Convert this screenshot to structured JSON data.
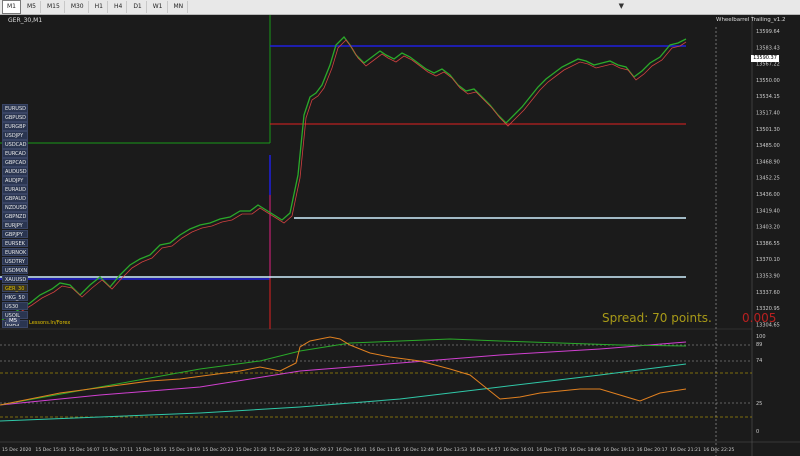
{
  "toolbar": {
    "timeframes": [
      "M1",
      "M5",
      "M15",
      "M30",
      "H1",
      "H4",
      "D1",
      "W1",
      "MN"
    ],
    "active": "M1"
  },
  "chart": {
    "symbol_title": "GER_30,M1",
    "indicator_label": "Wheelbarrel Trailing_v1.2",
    "current_price": "13590.37",
    "symbols": [
      "EURUSD",
      "GBPUSD",
      "EURGBP",
      "USDJPY",
      "USDCAD",
      "EURCAD",
      "GBPCAD",
      "AUDUSD",
      "AUDJPY",
      "EURAUD",
      "GBPAUD",
      "NZDUSD",
      "GBPNZD",
      "EURJPY",
      "GBPJPY",
      "EURSEK",
      "EURNOK",
      "USDTRY",
      "USDMXN",
      "XAUUSD",
      "GER_30",
      "HKG_50",
      "US30",
      "USOIL",
      "NGAS"
    ],
    "highlighted_symbol": "GER_30",
    "timeframe_box": "M5",
    "watermark": "Lessons.In/Forex",
    "spread_text": "Spread: 70 points.",
    "spread_value": "0.005",
    "price_labels": [
      "13599.64",
      "13583.43",
      "13567.22",
      "13550.00",
      "13534.15",
      "13517.40",
      "13501.30",
      "13485.00",
      "13468.90",
      "13452.25",
      "13436.00",
      "13419.40",
      "13403.20",
      "13386.55",
      "13370.10",
      "13353.90",
      "13337.60",
      "13320.95",
      "13304.65"
    ],
    "indicator_scale": [
      "100",
      "89",
      "74",
      "25",
      "0"
    ],
    "time_labels": [
      "15 Dec 2020",
      "15 Dec 15:03",
      "15 Dec 16:07",
      "15 Dec 17:11",
      "15 Dec 18:15",
      "15 Dec 19:19",
      "15 Dec 20:23",
      "15 Dec 21:28",
      "15 Dec 22:32",
      "16 Dec 09:37",
      "16 Dec 10:41",
      "16 Dec 11:45",
      "16 Dec 12:49",
      "16 Dec 13:53",
      "16 Dec 14:57",
      "16 Dec 16:01",
      "16 Dec 17:05",
      "16 Dec 18:09",
      "16 Dec 19:13",
      "16 Dec 20:17",
      "16 Dec 21:21",
      "16 Dec 22:25"
    ]
  },
  "colors": {
    "bg": "#1b1b1b",
    "blue_line": "#2020e0",
    "red_line": "#e02020",
    "green_line": "#1a9a1a",
    "cyan_line": "#cfefff",
    "price_up": "#2aaa2a",
    "price_dn": "#d04040",
    "magenta": "#d040d0",
    "teal": "#30c8a8"
  }
}
